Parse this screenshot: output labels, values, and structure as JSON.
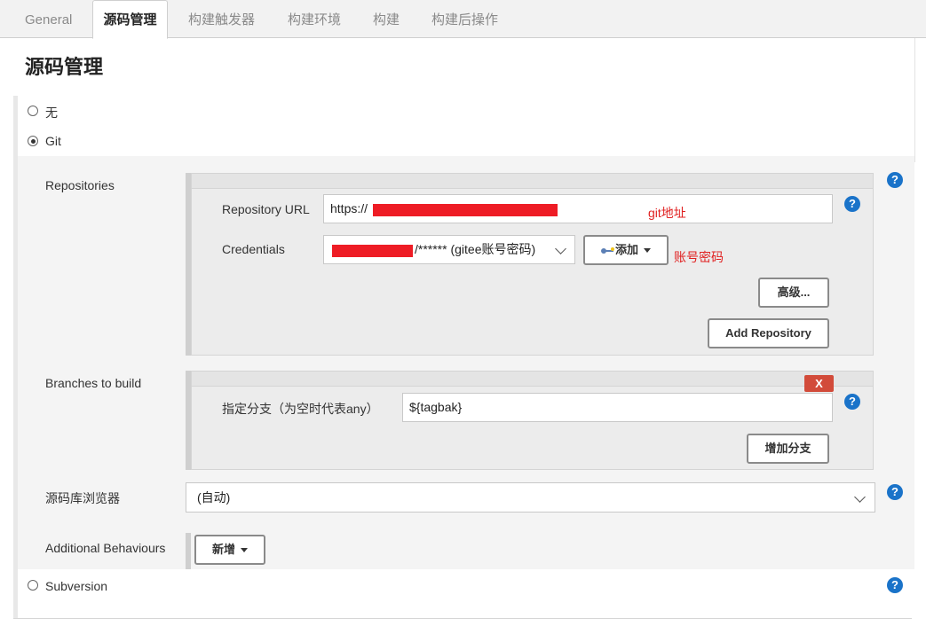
{
  "tabs": [
    {
      "label": "General"
    },
    {
      "label": "源码管理"
    },
    {
      "label": "构建触发器"
    },
    {
      "label": "构建环境"
    },
    {
      "label": "构建"
    },
    {
      "label": "构建后操作"
    }
  ],
  "section_title": "源码管理",
  "scm_options": {
    "none": "无",
    "git": "Git",
    "subversion": "Subversion"
  },
  "git": {
    "repositories_label": "Repositories",
    "repository_url_label": "Repository URL",
    "repository_url_value": "https://",
    "credentials_label": "Credentials",
    "credentials_value": "/****** (gitee账号密码)",
    "add_credentials_button": "添加",
    "advanced_button": "高级...",
    "add_repository_button": "Add Repository",
    "branches_label": "Branches to build",
    "branch_delete_button": "X",
    "branch_specifier_label": "指定分支（为空时代表any）",
    "branch_specifier_value": "${tagbak}",
    "add_branch_button": "增加分支",
    "repo_browser_label": "源码库浏览器",
    "repo_browser_value": "(自动)",
    "additional_behaviours_label": "Additional Behaviours",
    "add_behaviour_button": "新增"
  },
  "annotations": {
    "git_address": "git地址",
    "account_password": "账号密码"
  },
  "help_icon": "?",
  "colors": {
    "help_icon": "#1a73c9",
    "redaction": "#ee1c25",
    "delete_button": "#d24b3a",
    "annotation": "#e02020"
  }
}
